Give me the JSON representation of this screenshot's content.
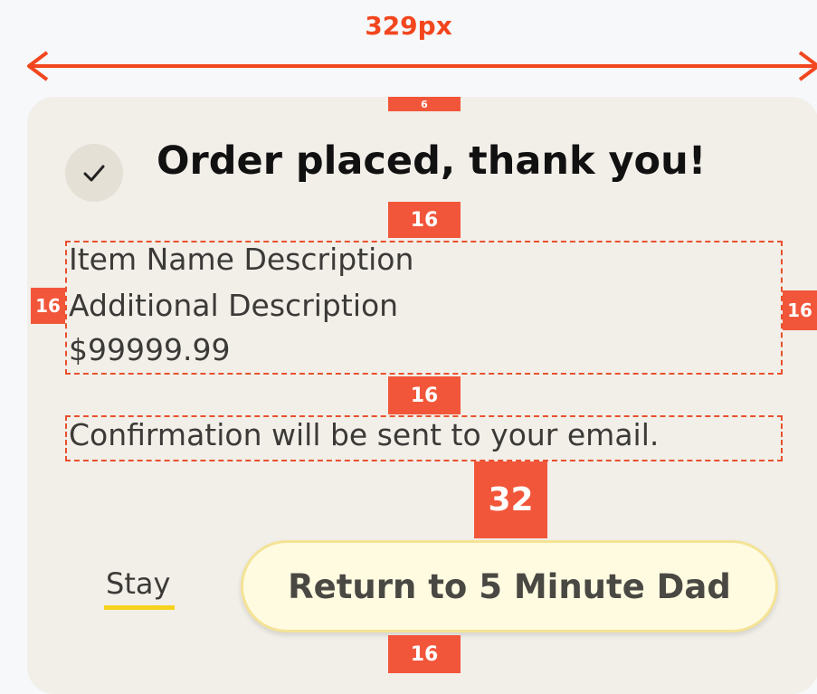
{
  "annotation": {
    "width_label": "329px",
    "spacing_top": "6",
    "spacing_after_title": "16",
    "padding_left": "16",
    "padding_right": "16",
    "spacing_after_details": "16",
    "spacing_before_buttons": "32",
    "spacing_bottom": "16",
    "accent_color": "#f2461e"
  },
  "dialog": {
    "icon": "checkmark-icon",
    "title": "Order placed, thank you!",
    "item_name": "Item Name Description",
    "item_additional": "Additional Description",
    "item_price": "$99999.99",
    "confirmation": "Confirmation will be sent to your email.",
    "stay_label": "Stay",
    "return_label": "Return to 5 Minute Dad",
    "highlight_color": "#f6d21c"
  }
}
